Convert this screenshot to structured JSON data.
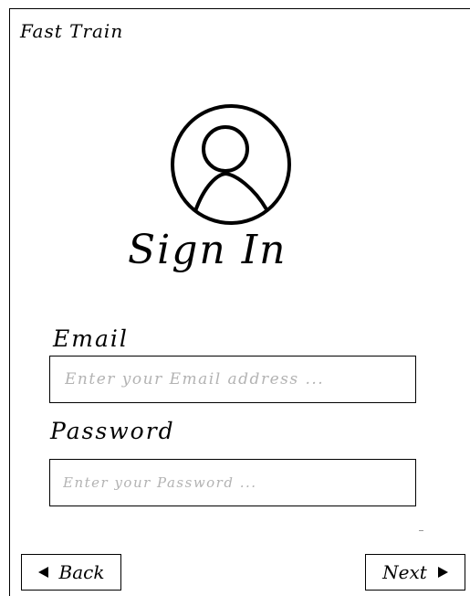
{
  "app": {
    "title": "Fast Train"
  },
  "page": {
    "heading": "Sign In"
  },
  "form": {
    "email": {
      "label": "Email",
      "placeholder": "Enter your Email address ...",
      "value": ""
    },
    "password": {
      "label": "Password",
      "placeholder": "Enter your Password ...",
      "value": ""
    }
  },
  "nav": {
    "back_label": "Back",
    "next_label": "Next",
    "back_icon": "triangle-left-icon",
    "next_icon": "triangle-right-icon"
  },
  "icons": {
    "avatar": "user-avatar-icon"
  }
}
